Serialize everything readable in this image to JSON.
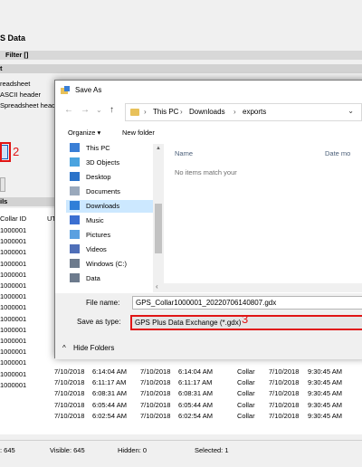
{
  "app": {
    "section_title": "S Data",
    "filter_bar": "Filter []",
    "settings_bar": "t",
    "options": [
      "readsheet",
      "ASCII header",
      "Spreadsheet heade"
    ],
    "details_bar": "ils",
    "columns": [
      "Collar ID",
      "UT"
    ],
    "collar_ids": [
      "1000001",
      "1000001",
      "1000001",
      "1000001",
      "1000001",
      "1000001",
      "1000001",
      "1000001",
      "1000001",
      "1000001",
      "1000001",
      "1000001",
      "1000001",
      "1000001",
      "1000001"
    ],
    "rows": [
      {
        "collar": "1000001",
        "d1": "7/10/2018",
        "t1": "6:14:04 AM",
        "d2": "7/10/2018",
        "t2": "6:14:04 AM",
        "type": "Collar",
        "d3": "7/10/2018",
        "t3": "9:30:45 AM"
      },
      {
        "collar": "1000001",
        "d1": "7/10/2018",
        "t1": "6:11:17 AM",
        "d2": "7/10/2018",
        "t2": "6:11:17 AM",
        "type": "Collar",
        "d3": "7/10/2018",
        "t3": "9:30:45 AM"
      },
      {
        "collar": "1000001",
        "d1": "7/10/2018",
        "t1": "6:08:31 AM",
        "d2": "7/10/2018",
        "t2": "6:08:31 AM",
        "type": "Collar",
        "d3": "7/10/2018",
        "t3": "9:30:45 AM"
      },
      {
        "collar": "1000001",
        "d1": "7/10/2018",
        "t1": "6:05:44 AM",
        "d2": "7/10/2018",
        "t2": "6:05:44 AM",
        "type": "Collar",
        "d3": "7/10/2018",
        "t3": "9:30:45 AM"
      },
      {
        "collar": "1000001",
        "d1": "7/10/2018",
        "t1": "6:02:54 AM",
        "d2": "7/10/2018",
        "t2": "6:02:54 AM",
        "type": "Collar",
        "d3": "7/10/2018",
        "t3": "9:30:45 AM"
      }
    ],
    "status": {
      "total": ": 645",
      "visible": "Visible: 645",
      "hidden": "Hidden: 0",
      "selected": "Selected: 1"
    },
    "step2": "2",
    "step3": "3"
  },
  "dialog": {
    "title": "Save As",
    "nav": {
      "back": "←",
      "forward": "→",
      "dropdown": "⌄",
      "up": "↑"
    },
    "address": [
      "This PC",
      "Downloads",
      "exports"
    ],
    "address_sep": "›",
    "address_dropdown": "⌄",
    "organize": "Organize ▾",
    "new_folder": "New folder",
    "nav_items": [
      {
        "label": "This PC",
        "icon": "computer-icon"
      },
      {
        "label": "3D Objects",
        "icon": "cube-icon"
      },
      {
        "label": "Desktop",
        "icon": "desktop-icon"
      },
      {
        "label": "Documents",
        "icon": "document-icon"
      },
      {
        "label": "Downloads",
        "icon": "download-icon"
      },
      {
        "label": "Music",
        "icon": "music-icon"
      },
      {
        "label": "Pictures",
        "icon": "picture-icon"
      },
      {
        "label": "Videos",
        "icon": "video-icon"
      },
      {
        "label": "Windows (C:)",
        "icon": "drive-icon"
      },
      {
        "label": "Data",
        "icon": "drive-icon"
      }
    ],
    "columns": {
      "name": "Name",
      "date": "Date mo"
    },
    "empty_message": "No items match your",
    "file_name_label": "File name:",
    "file_name_value": "GPS_Collar1000001_20220706140807.gdx",
    "save_type_label": "Save as type:",
    "save_type_value": "GPS Plus Data Exchange (*.gdx)",
    "hide_folders": "Hide Folders",
    "hide_folders_icon": "^",
    "colors": {
      "selected": "#cce8ff",
      "highlight": "#e01515"
    }
  }
}
